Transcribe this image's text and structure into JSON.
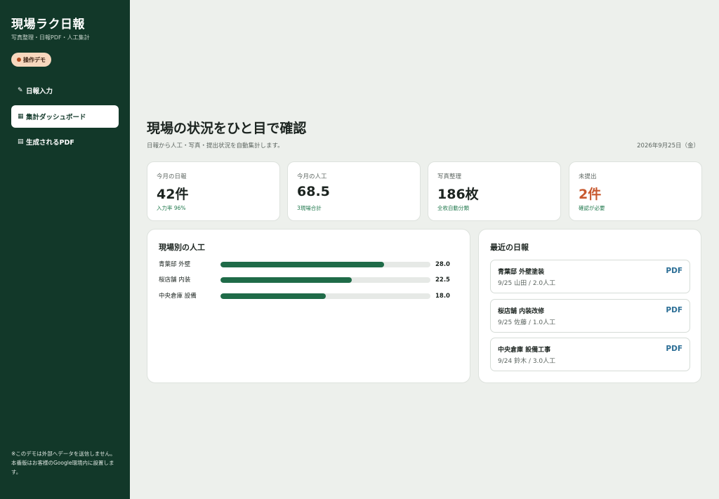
{
  "sidebar": {
    "title": "現場ラク日報",
    "subtitle": "写真整理・日報PDF・人工集計",
    "badge": "操作デモ",
    "nav": [
      {
        "icon": "✎",
        "label": "日報入力"
      },
      {
        "icon": "▦",
        "label": "集計ダッシュボード"
      },
      {
        "icon": "▤",
        "label": "生成されるPDF"
      }
    ],
    "note_lines": [
      "※このデモは外部へデータを送信しません。",
      "本番版はお客様のGoogle環境内に設置します。"
    ]
  },
  "header": {
    "title": "現場の状況をひと目で確認",
    "subtitle": "日報から人工・写真・提出状況を自動集計します。",
    "date": "2026年9月25日（金）"
  },
  "stats": [
    {
      "label": "今月の日報",
      "value": "42件",
      "note": "入力率 96%"
    },
    {
      "label": "今月の人工",
      "value": "68.5",
      "note": "3現場合計"
    },
    {
      "label": "写真整理",
      "value": "186枚",
      "note": "全枚自動分類"
    },
    {
      "label": "未提出",
      "value": "2件",
      "note": "確認が必要",
      "alert_color": "#c85a30"
    }
  ],
  "sites_panel": {
    "title": "現場別の人工",
    "max": 36,
    "rows": [
      {
        "label": "青葉邸 外壁",
        "value": "28.0",
        "amount": 28.0
      },
      {
        "label": "桜店舗 内装",
        "value": "22.5",
        "amount": 22.5
      },
      {
        "label": "中央倉庫 設備",
        "value": "18.0",
        "amount": 18.0
      }
    ]
  },
  "reports_panel": {
    "title": "最近の日報",
    "items": [
      {
        "name": "青葉邸 外壁塗装",
        "meta": "9/25 山田 / 2.0人工",
        "action": "PDF"
      },
      {
        "name": "桜店舗 内装改修",
        "meta": "9/25 佐藤 / 1.0人工",
        "action": "PDF"
      },
      {
        "name": "中央倉庫 設備工事",
        "meta": "9/24 鈴木 / 3.0人工",
        "action": "PDF"
      }
    ]
  },
  "colors": {
    "sidebar_bg": "#123829",
    "accent_green": "#1f6b48",
    "alert": "#c85a30",
    "link": "#2a6d95"
  }
}
